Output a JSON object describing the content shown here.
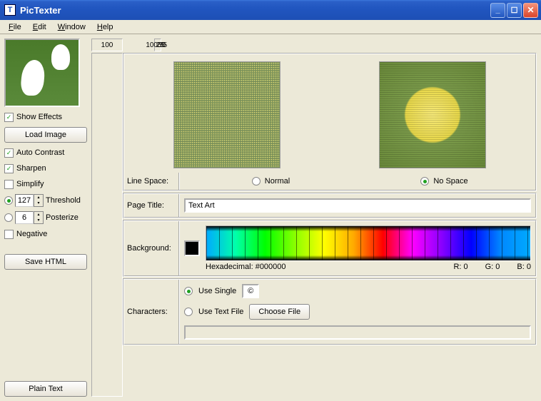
{
  "window": {
    "title": "PicTexter",
    "icon_glyph": "T"
  },
  "menus": {
    "file": "File",
    "edit": "Edit",
    "window": "Window",
    "help": "Help"
  },
  "sidebar": {
    "show_effects": "Show Effects",
    "load_image": "Load Image",
    "auto_contrast": "Auto Contrast",
    "sharpen": "Sharpen",
    "simplify": "Simplify",
    "threshold_value": "127",
    "threshold_label": "Threshold",
    "posterize_value": "6",
    "posterize_label": "Posterize",
    "negative": "Negative",
    "save_html": "Save HTML",
    "plain_text": "Plain Text"
  },
  "ruler": {
    "corner": "100",
    "t25": "25",
    "t50": "50",
    "t75": "75",
    "t100": "100"
  },
  "line_space": {
    "label": "Line Space:",
    "normal": "Normal",
    "no_space": "No Space"
  },
  "page_title": {
    "label": "Page Title:",
    "value": "Text Art"
  },
  "background": {
    "label": "Background:",
    "hex_label": "Hexadecimal: #000000",
    "r": "R: 0",
    "g": "G: 0",
    "b": "B: 0"
  },
  "characters": {
    "label": "Characters:",
    "use_single": "Use Single",
    "single_char": "©",
    "use_text_file": "Use Text File",
    "choose_file": "Choose File"
  }
}
